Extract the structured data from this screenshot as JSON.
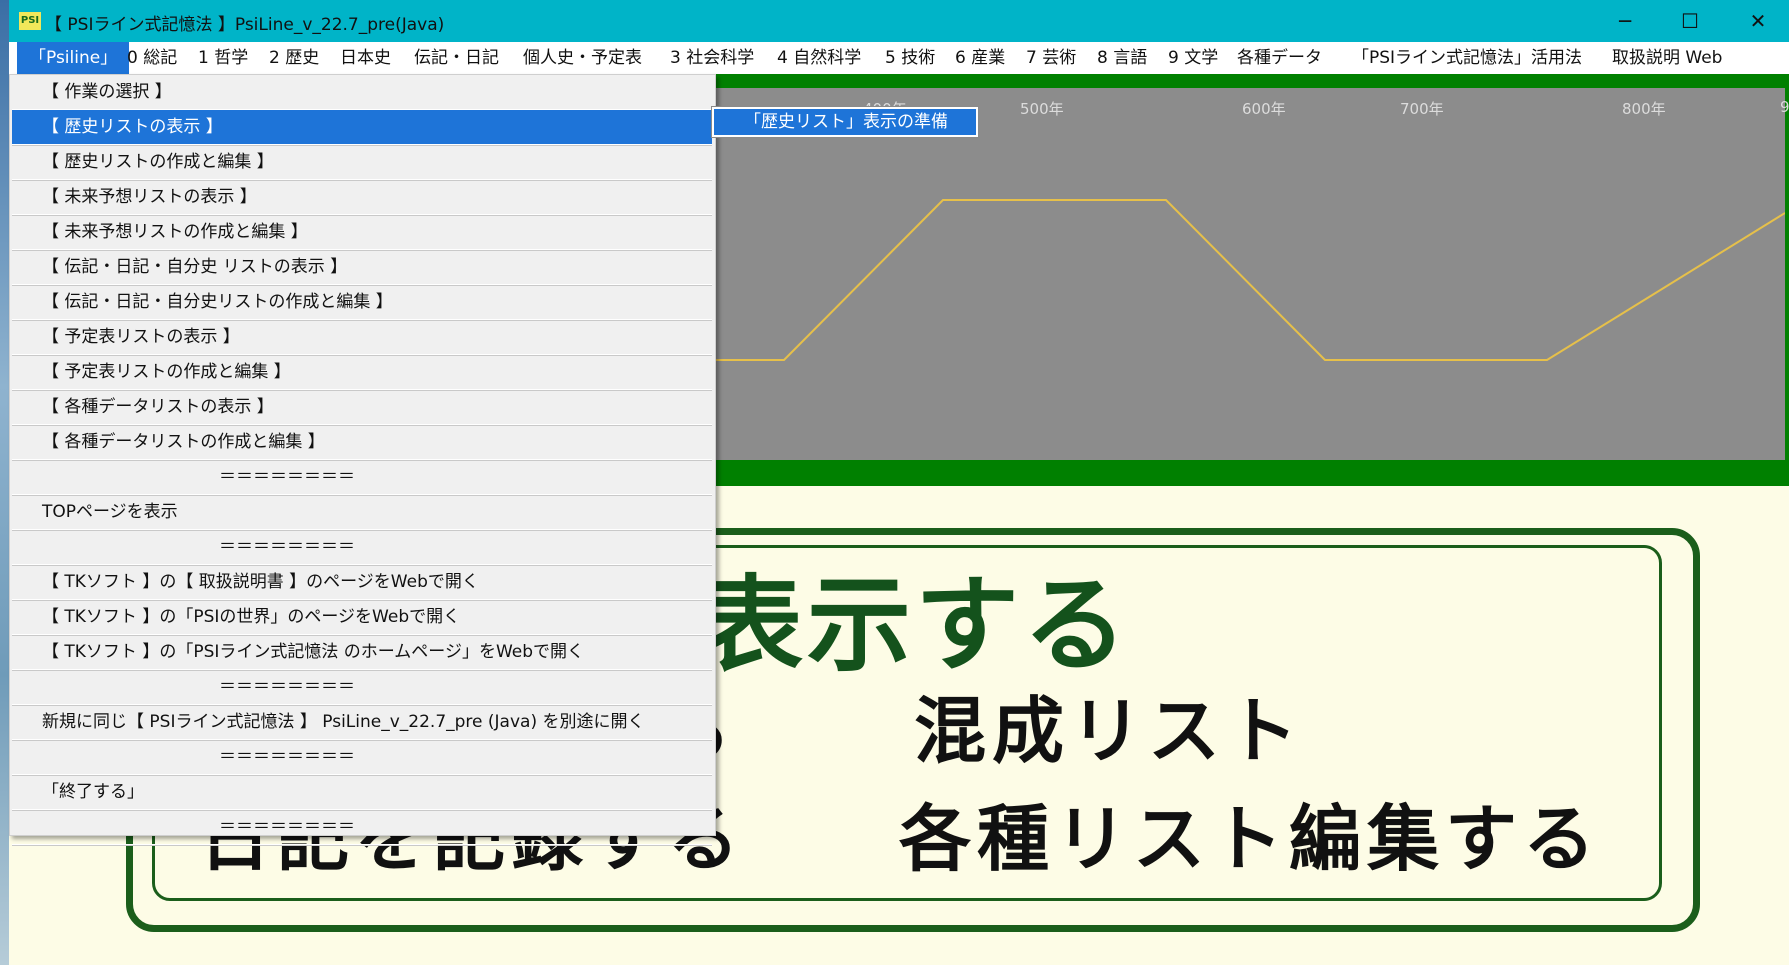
{
  "window": {
    "icon_text": "PSI",
    "title": "【 PSIライン式記憶法 】PsiLine_v_22.7_pre(Java)",
    "buttons": {
      "minimize": "─",
      "maximize": "☐",
      "close": "✕"
    }
  },
  "menubar": {
    "items": [
      "「Psiline」",
      "0 総記",
      "1 哲学",
      "2 歴史",
      "日本史",
      "伝記・日記",
      "個人史・予定表",
      "3 社会科学",
      "4 自然科学",
      "5 技術",
      "6 産業",
      "7 芸術",
      "8 言語",
      "9 文学",
      "各種データ",
      "「PSIライン式記憶法」活用法",
      "取扱説明 Web"
    ],
    "active_index": 0
  },
  "graph": {
    "year_labels": [
      "400年",
      "500年",
      "600年",
      "700年",
      "800年",
      "9"
    ],
    "line_color": "#e6c04a",
    "panel_color": "#8c8c8c",
    "frame_color": "#008000"
  },
  "card": {
    "big_green": "表示する",
    "row1_left": "る",
    "row1_right": "混成リスト",
    "row2_left": "日記を記録する",
    "row2_right": "各種リスト編集する"
  },
  "dropdown": {
    "items": [
      "【 作業の選択 】",
      "【 歴史リストの表示 】",
      "【 歴史リストの作成と編集 】",
      "【 未来予想リストの表示 】",
      "【 未来予想リストの作成と編集 】",
      "【 伝記・日記・自分史 リストの表示 】",
      "【 伝記・日記・自分史リストの作成と編集 】",
      "【 予定表リストの表示 】",
      "【 予定表リストの作成と編集 】",
      "【 各種データリストの表示 】",
      "【 各種データリストの作成と編集 】",
      "＝＝＝＝＝＝＝＝",
      "TOPページを表示",
      "＝＝＝＝＝＝＝＝",
      "【 TKソフト 】の【 取扱説明書 】のページをWebで開く",
      "【 TKソフト 】の「PSIの世界」のページをWebで開く",
      "【 TKソフト 】の「PSIライン式記憶法 のホームページ」をWebで開く",
      "＝＝＝＝＝＝＝＝",
      "新規に同じ【 PSIライン式記憶法 】 PsiLine_v_22.7_pre (Java) を別途に開く",
      "＝＝＝＝＝＝＝＝",
      "「終了する」",
      "＝＝＝＝＝＝＝＝"
    ],
    "highlighted_index": 1,
    "submenu_label": "「歴史リスト」表示の準備"
  },
  "colors": {
    "titlebar": "#00b4c8",
    "highlight": "#1e74d8",
    "card_green": "#1b5e1b"
  }
}
